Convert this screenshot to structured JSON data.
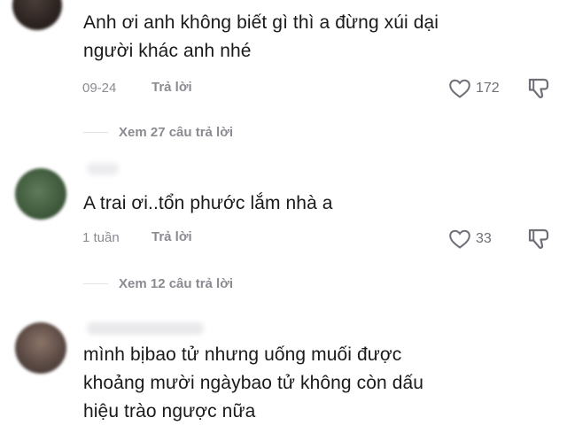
{
  "comments": [
    {
      "text_lines": [
        "Anh ơi anh không biết gì thì a đừng xúi dại",
        "người khác anh nhé"
      ],
      "date": "09-24",
      "reply_label": "Trả lời",
      "likes": "172",
      "view_replies": "Xem 27 câu trả lời"
    },
    {
      "text_lines": [
        "A trai ơi..tổn phước lắm nhà a"
      ],
      "date": "1 tuần",
      "reply_label": "Trả lời",
      "likes": "33",
      "view_replies": "Xem 12 câu trả lời"
    },
    {
      "text_lines": [
        "mình bịbao tử nhưng uống muối được",
        "khoảng mười ngàybao tử không còn dấu",
        "hiệu trào ngược nữa"
      ]
    }
  ],
  "icons": {
    "like": "heart-outline-icon",
    "dislike": "thumbs-down-icon"
  },
  "colors": {
    "text": "#1a1a1a",
    "meta": "#8a8b91",
    "divider": "#e3e3e6"
  }
}
